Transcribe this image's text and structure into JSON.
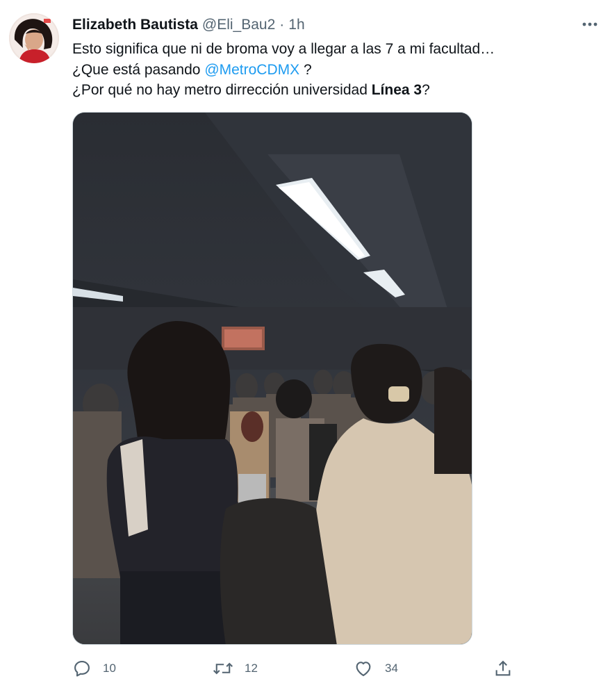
{
  "tweet": {
    "author_name": "Elizabeth Bautista",
    "handle": "@Eli_Bau2",
    "separator": "·",
    "time": "1h",
    "avatar_icon": "user-avatar",
    "more_icon": "more-options-icon",
    "text": {
      "line1": "Esto significa que ni de broma voy a llegar a las 7 a mi facultad…",
      "line2_prefix": "¿Que está pasando",
      "line2_mention": "@MetroCDMX",
      "line2_suffix": "?",
      "line3_prefix": "¿Por qué no hay metro dirrección universidad",
      "line3_bold": "Línea 3",
      "line3_suffix": "?"
    },
    "media": {
      "kind": "photo",
      "scene": "crowded metro platform"
    },
    "actions": {
      "reply_count": "10",
      "retweet_count": "12",
      "like_count": "34"
    }
  },
  "colors": {
    "text": "#0f1419",
    "secondary": "#536471",
    "link": "#1d9bf0",
    "border": "#cfd9de"
  }
}
